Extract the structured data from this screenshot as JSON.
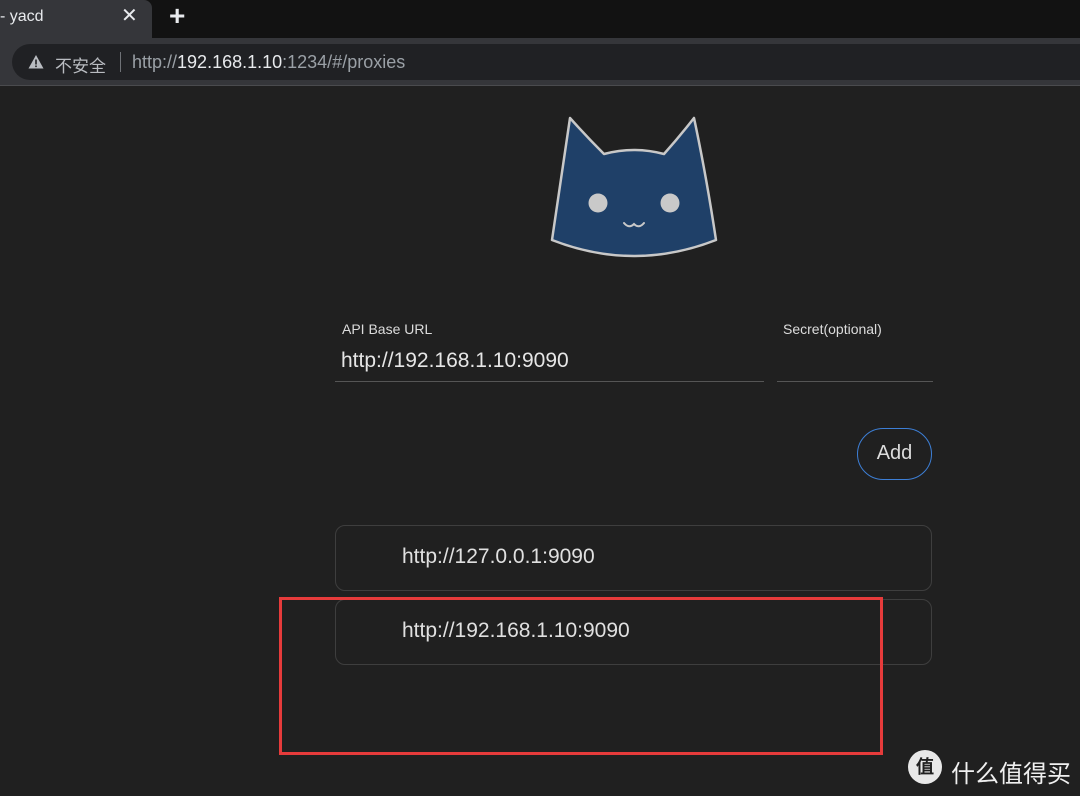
{
  "browser": {
    "tab_title": "- yacd",
    "tab_close": "✕",
    "new_tab": "+",
    "security_label": "不安全",
    "url_scheme": "http://",
    "url_host": "192.168.1.10",
    "url_rest": ":1234/#/proxies"
  },
  "form": {
    "api_label": "API Base URL",
    "api_value": "http://192.168.1.10:9090",
    "secret_label": "Secret(optional)",
    "secret_value": "",
    "add_label": "Add"
  },
  "backends": [
    {
      "url": "http://127.0.0.1:9090"
    },
    {
      "url": "http://192.168.1.10:9090"
    }
  ],
  "watermark": {
    "icon_text": "值",
    "text": "什么值得买"
  },
  "colors": {
    "logo_fill": "#1f4068",
    "accent": "#3d7fd6",
    "highlight": "#e63b3b"
  }
}
